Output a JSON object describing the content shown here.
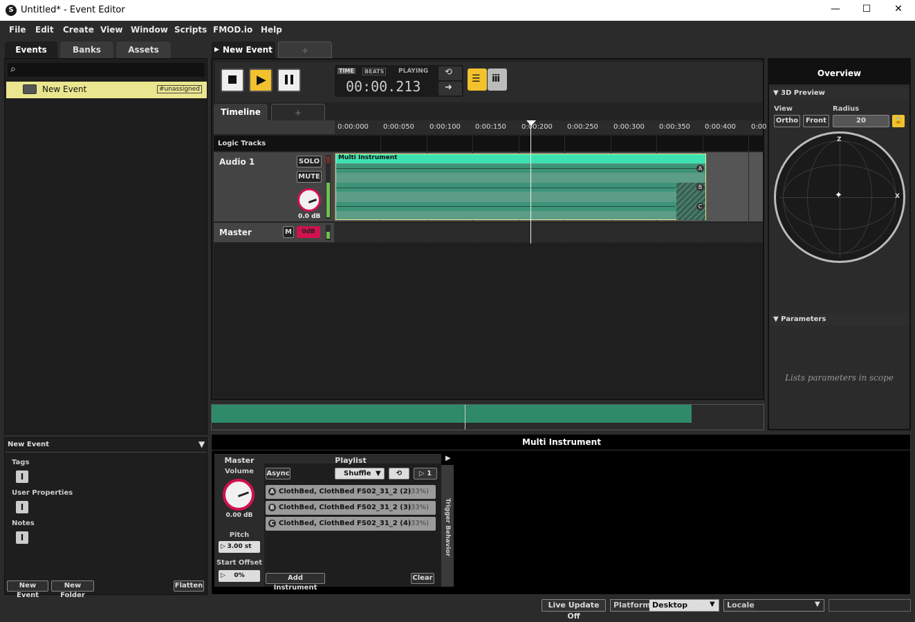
{
  "window": {
    "title": "Untitled* - Event Editor",
    "minimize": "—",
    "maximize": "☐",
    "close": "✕"
  },
  "menu": [
    "File",
    "Edit",
    "Create",
    "View",
    "Window",
    "Scripts",
    "FMOD.io",
    "Help"
  ],
  "browser": {
    "tabs": [
      "Events",
      "Banks",
      "Assets"
    ],
    "items": [
      {
        "label": "New Event",
        "tag": "#unassigned"
      }
    ],
    "props_title": "New Event",
    "sections": [
      "Tags",
      "User Properties",
      "Notes"
    ],
    "buttons": {
      "new_event": "New Event",
      "new_folder": "New Folder",
      "flatten": "Flatten"
    }
  },
  "editor": {
    "event_tab": "New Event",
    "add_tab": "+",
    "transport": {
      "time_label": "TIME",
      "beats_label": "BEATS",
      "state": "PLAYING",
      "time": "00:00.213"
    },
    "timeline_tab": "Timeline",
    "ruler": [
      "0:00:000",
      "0:00:050",
      "0:00:100",
      "0:00:150",
      "0:00:200",
      "0:00:250",
      "0:00:300",
      "0:00:350",
      "0:00:400",
      "0:00"
    ],
    "logic_tracks": "Logic Tracks",
    "audio_track": {
      "name": "Audio 1",
      "solo": "SOLO",
      "mute": "MUTE",
      "volume": "0.0 dB"
    },
    "master_track": {
      "name": "Master",
      "m": "M",
      "vol": "0dB"
    },
    "instrument": {
      "name": "Multi Instrument",
      "lanes": [
        "A",
        "B",
        "C"
      ]
    },
    "overview_progress": 0.55
  },
  "overview": {
    "title": "Overview",
    "preview_header": "3D Preview",
    "view_label": "View",
    "radius_label": "Radius",
    "ortho": "Ortho",
    "front": "Front",
    "radius": "20",
    "axis_z": "Z",
    "axis_x": "X",
    "parameters_header": "Parameters",
    "parameters_hint": "Lists parameters in scope"
  },
  "deck": {
    "title": "Multi Instrument",
    "master": "Master",
    "volume_label": "Volume",
    "volume": "0.00 dB",
    "pitch_label": "Pitch",
    "pitch": "3.00 st",
    "start_offset_label": "Start Offset",
    "start_offset": "0%",
    "playlist": "Playlist",
    "async": "Async",
    "mode": "Shuffle",
    "count": "1",
    "items": [
      {
        "id": "A",
        "name": "ClothBed, ClothBed FS02_31_2 (2)",
        "pct": "(33%)"
      },
      {
        "id": "B",
        "name": "ClothBed, ClothBed FS02_31_2 (3)",
        "pct": "(33%)"
      },
      {
        "id": "C",
        "name": "ClothBed, ClothBed FS02_31_2 (4)",
        "pct": "(33%)"
      }
    ],
    "add_instrument": "Add Instrument",
    "clear": "Clear",
    "trigger_behavior": "Trigger Behavior"
  },
  "statusbar": {
    "live_update": "Live Update Off",
    "platform_label": "Platform",
    "platform": "Desktop",
    "locale_label": "Locale",
    "locale": ""
  },
  "colors": {
    "accent": "#f2c12e",
    "instrument": "#3ee2b0",
    "instrument_lane": "#3e9479",
    "selected": "#e9e68f"
  }
}
